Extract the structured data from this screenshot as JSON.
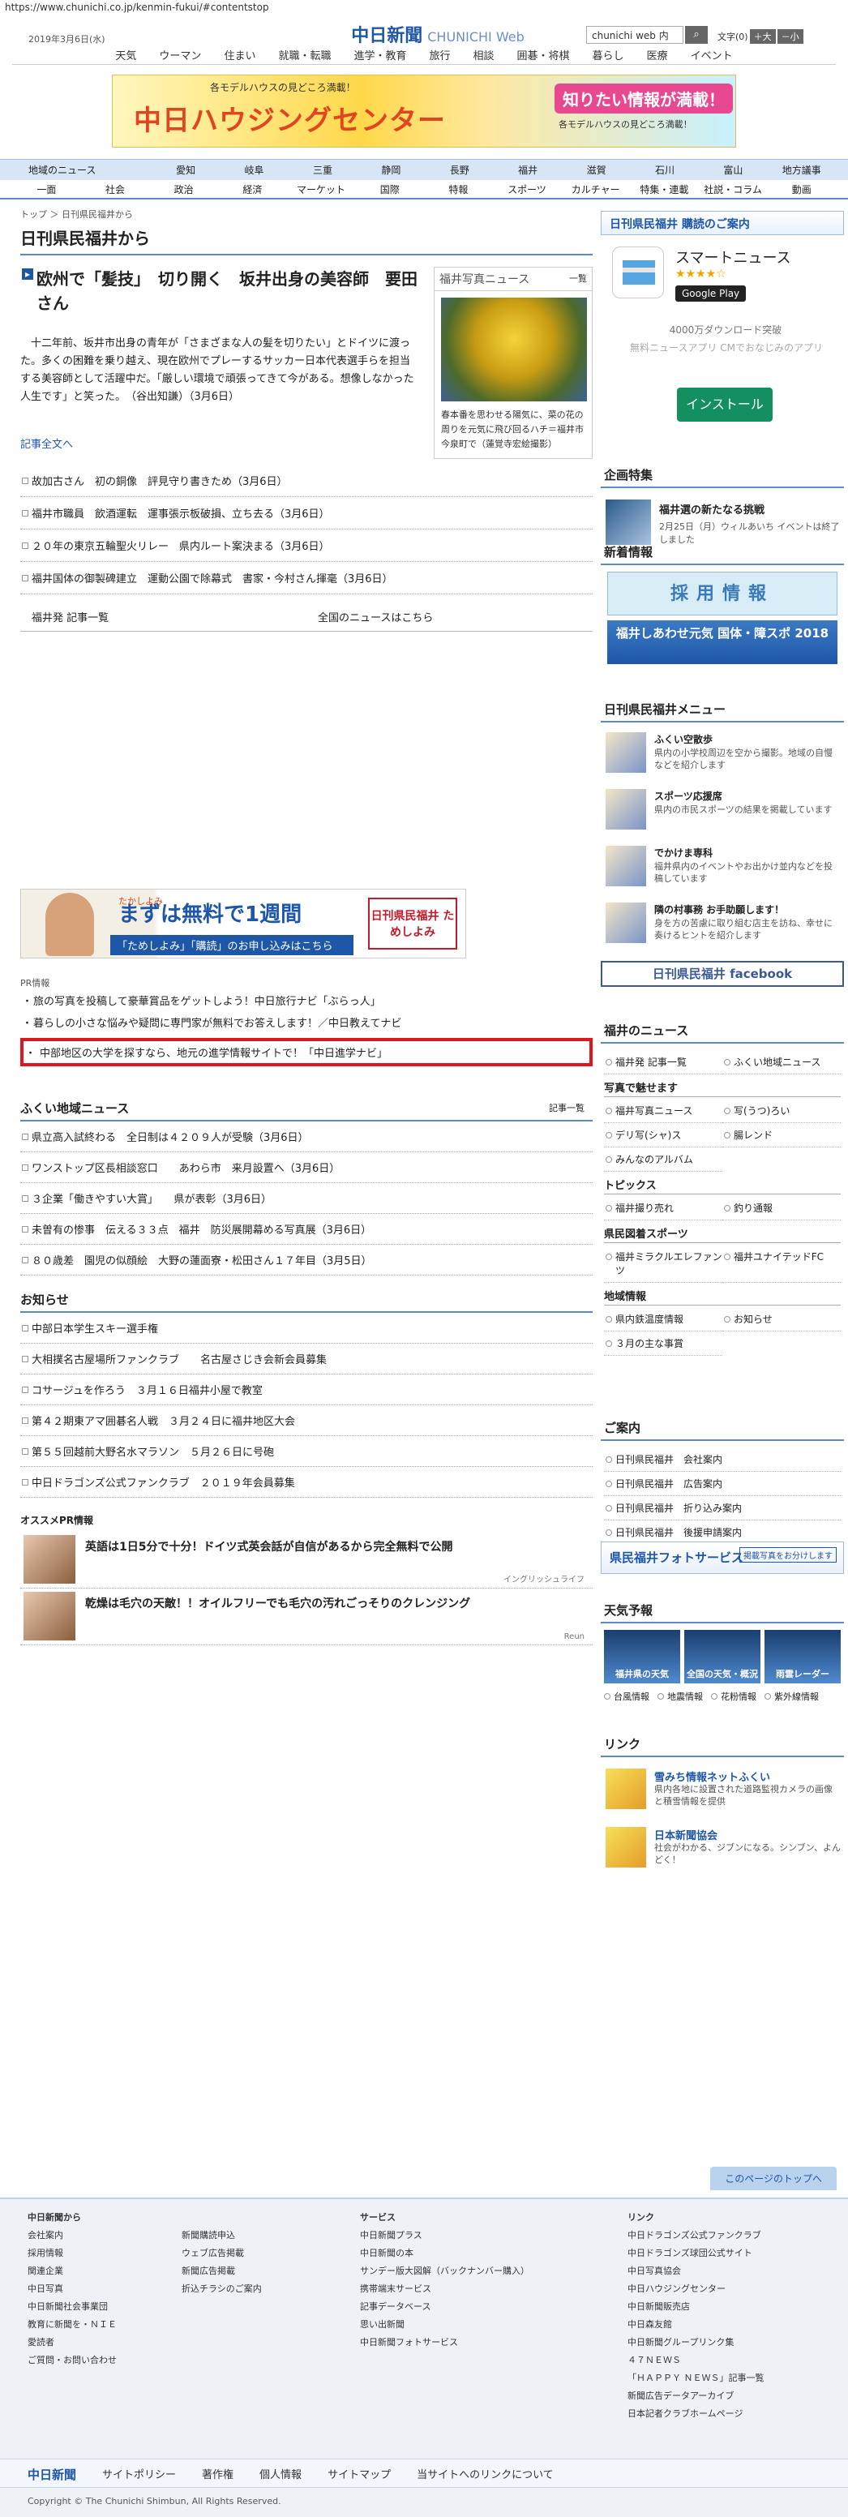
{
  "url": "https://www.chunichi.co.jp/kenmin-fukui/#contentstop",
  "header": {
    "date": "2019年3月6日(水)",
    "logo_jp": "中日新聞",
    "logo_en": "CHUNICHI Web",
    "search_value": "chunichi web 内",
    "search_icon": "search-icon",
    "font_label": "文字",
    "font_size_value": "(0)",
    "font_plus": "＋大",
    "font_minus": "－小"
  },
  "gnav": [
    "天気",
    "ウーマン",
    "住まい",
    "就職・転職",
    "進学・教育",
    "旅行",
    "相談",
    "囲碁・将棋",
    "暮らし",
    "医療",
    "イベント"
  ],
  "banner": {
    "small": "各モデルハウスの見どころ満載！",
    "main": "中日ハウジングセンター",
    "badge": "知りたい情報が満載！",
    "sub": "各モデルハウスの見どころ満載！"
  },
  "region_nav": [
    "地域のニュース",
    "愛知",
    "岐阜",
    "三重",
    "静岡",
    "長野",
    "福井",
    "滋賀",
    "石川",
    "富山",
    "地方議事"
  ],
  "sub_nav": [
    "一面",
    "社会",
    "政治",
    "経済",
    "マーケット",
    "国際",
    "特報",
    "スポーツ",
    "カルチャー",
    "特集・連載",
    "社説・コラム",
    "動画"
  ],
  "main": {
    "breadcrumb": "トップ ＞ 日刊県民福井から",
    "page_title": "日刊県民福井から",
    "headline": "欧州で「髪技」　切り開く　坂井出身の美容師　要田さん",
    "lead": "十二年前、坂井市出身の青年が「さまざまな人の髪を切りたい」とドイツに渡った。多くの困難を乗り越え、現在欧州でプレーするサッカー日本代表選手らを担当する美容師として活躍中だ。「厳しい環境で頑張ってきて今がある。想像しなかった人生です」と笑った。　（谷出知謙）（3月6日）",
    "full_article": "記事全文へ",
    "photo_header": "福井写真ニュース",
    "photo_link": "一覧",
    "photo_caption": "春本番を思わせる陽気に、菜の花の周りを元気に飛び回るハチ＝福井市今泉町で（蓮覚寺宏絵撮影）",
    "articles": [
      "故加古さん　初の銅像　評見守り書きため（3月6日）",
      "福井市職員　飲酒運転　運事張示板破損、立ち去る（3月6日）",
      "２０年の東京五輪聖火リレー　県内ルート案決まる（3月6日）",
      "福井国体の御製碑建立　運動公園で除幕式　書家・今村さん揮毫（3月6日）"
    ],
    "more_left": "福井発 記事一覧",
    "more_right": "全国のニュースはこちら",
    "ad2": {
      "small": "たかしよみ",
      "big": "まずは無料で1週間",
      "bottom": "「ためしよみ」「購読」のお申し込みはこちら",
      "brand": "日刊県民福井 ためしよみ"
    },
    "pr_label": "PR情報",
    "pr_items": [
      "旅の写真を投稿して豪華賞品をゲットしよう！中日旅行ナビ「ぶらっ人」",
      "暮らしの小さな悩みや疑問に専門家が無料でお答えします！／中日教えてナビ",
      "中部地区の大学を探すなら、地元の進学情報サイトで！「中日進学ナビ」"
    ],
    "local_title": "ふくい地域ニュース",
    "local_more": "記事一覧",
    "local_items": [
      "県立高入試終わる　全日制は４２０９人が受験（3月6日）",
      "ワンストップ区長相談窓口　　あわら市　来月設置へ（3月6日）",
      "３企業「働きやすい大賞」　　県が表彰（3月6日）",
      "未曽有の惨事　伝える３３点　福井　防災展開幕める写真展（3月6日）",
      "８０歳差　園児の似顔絵　大野の蓮面寮・松田さん１７年目（3月5日）"
    ],
    "notice_title": "お知らせ",
    "notice_items": [
      "中部日本学生スキー選手権",
      "大相撲名古屋場所ファンクラブ　　名古屋さじき会新会員募集",
      "コサージュを作ろう　３月１６日福井小屋で教室",
      "第４２期東アマ囲碁名人戦　３月２４日に福井地区大会",
      "第５５回越前大野名水マラソン　５月２６日に号砲",
      "中日ドラゴンズ公式ファンクラブ　２０１９年会員募集"
    ],
    "osusume_label": "オススメPR情報",
    "osusume": [
      {
        "text": "英語は1日5分で十分！ドイツ式英会話が自信があるから完全無料で公開",
        "source": "イングリッシュライフ"
      },
      {
        "text": "乾燥は毛穴の天敵！！オイルフリーでも毛穴の汚れごっそりのクレンジング",
        "source": "Reun"
      }
    ]
  },
  "side": {
    "subscribe": "日刊県民福井 購読のご案内",
    "app": {
      "name": "スマートニュース",
      "stars": "★★★★☆",
      "store": "Google Play",
      "downloads": "4000万ダウンロード突破",
      "desc": "無料ニュースアプリ CMでおなじみのアプリ",
      "install": "インストール"
    },
    "feature_title": "企画特集",
    "feature_item": "福井選の新たなる挑戦",
    "feature_sub": "2月25日（月）ウィルあいち イベントは終了しました",
    "new_title": "新着情報",
    "recruit": "採用情報",
    "recruit2": "福井しあわせ元気 国体・障スポ 2018",
    "menu_title": "日刊県民福井メニュー",
    "menu": [
      {
        "t": "ふくい空散歩",
        "d": "県内の小学校周辺を空から撮影。地域の自慢などを紹介します"
      },
      {
        "t": "スポーツ応援席",
        "d": "県内の市民スポーツの結果を掲載しています"
      },
      {
        "t": "でかけま専科",
        "d": "福井県内のイベントやお出かけ並内などを投稿しています"
      },
      {
        "t": "隣の村事務 お手助願します！",
        "d": "身を方の苦慮に取り組む店主を訪ね、幸せに奏けるヒントを紹介します"
      }
    ],
    "facebook": "日刊県民福井 facebook",
    "news_title": "福井のニュース",
    "news_links": [
      "福井発 記事一覧",
      "ふくい地域ニュース"
    ],
    "photo_cat": "写真で魅せます",
    "photo_links": [
      "福井写真ニュース",
      "写(うつ)ろい",
      "デリ写(シャ)ス",
      "腸レンド",
      "みんなのアルバム"
    ],
    "topics_cat": "トピックス",
    "topics_links": [
      "福井撮り売れ",
      "釣り通報"
    ],
    "sports_cat": "県民図着スポーツ",
    "sports_links": [
      "福井ミラクルエレファンツ",
      "福井ユナイテッドFC"
    ],
    "area_cat": "地域情報",
    "area_links": [
      "県内鉄温度情報",
      "お知らせ",
      "３月の主な事賞"
    ],
    "guide_title": "ご案内",
    "guide_links": [
      "日刊県民福井　会社案内",
      "日刊県民福井　広告案内",
      "日刊県民福井　折り込み案内",
      "日刊県民福井　後援申請案内"
    ],
    "fphoto": "県民福井フォトサービス",
    "fphoto_badge": "掲載写真をお分けします",
    "weather_title": "天気予報",
    "weather": [
      "福井県の天気",
      "全国の天気・概況",
      "雨雲レーダー"
    ],
    "weather_links": [
      "台風情報",
      "地震情報",
      "花粉情報",
      "紫外線情報"
    ],
    "link_title": "リンク",
    "links": [
      {
        "t": "雪みち情報ネットふくい",
        "d": "県内各地に設置された道路監視カメラの画像と積雪情報を提供"
      },
      {
        "t": "日本新聞協会",
        "d": "社会がわかる、ジブンになる。シンブン、よんどく！"
      }
    ],
    "to_top": "このページのトップへ"
  },
  "footer": {
    "cols": [
      {
        "title": "中日新聞から",
        "items": [
          "会社案内",
          "採用情報",
          "関連企業",
          "中日写真",
          "中日新聞社会事業団",
          "教育に新聞を・ＮＩＥ",
          "愛読者",
          "ご質問・お問い合わせ"
        ]
      },
      {
        "title": "",
        "items": [
          "新聞購読申込",
          "ウェブ広告掲載",
          "新聞広告掲載",
          "折込チラシのご案内"
        ]
      },
      {
        "title": "サービス",
        "items": [
          "中日新聞プラス",
          "中日新聞の本",
          "サンデー版大図解（バックナンバー購入）",
          "携帯端末サービス",
          "記事データベース",
          "思い出新聞",
          "中日新聞フォトサービス"
        ]
      },
      {
        "title": "リンク",
        "items": [
          "中日ドラゴンズ公式ファンクラブ",
          "中日ドラゴンズ球団公式サイト",
          "中日写真協会",
          "中日ハウジングセンター",
          "中日新聞販売店",
          "中日森友館",
          "中日新聞グループリンク集",
          "４７ＮＥＷＳ",
          "「ＨＡＰＰＹ ＮＥＷＳ」記事一覧",
          "新聞広告データアーカイブ",
          "日本記者クラブホームページ"
        ]
      }
    ],
    "bottom": [
      "中日新聞",
      "サイトポリシー",
      "著作権",
      "個人情報",
      "サイトマップ",
      "当サイトへのリンクについて"
    ],
    "copyright": "Copyright © The Chunichi Shimbun, All Rights Reserved."
  }
}
